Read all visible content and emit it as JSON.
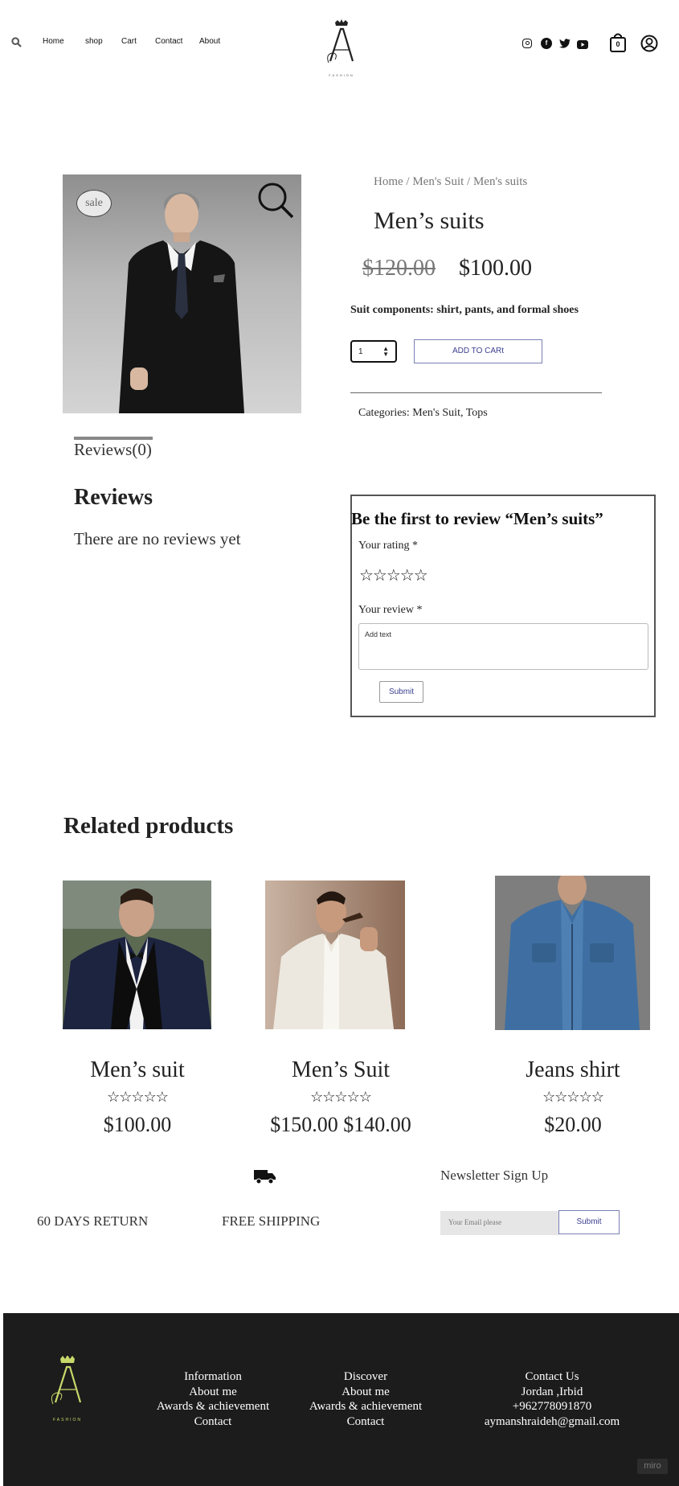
{
  "header": {
    "nav": [
      "Home",
      "shop",
      "Cart",
      "Contact",
      "About"
    ],
    "cart_count": "0",
    "logo_subtext": "FASHION"
  },
  "product": {
    "sale_badge": "sale",
    "breadcrumb": "Home / Men's Suit / Men's suits",
    "title": "Men’s suits",
    "old_price": "$120.00",
    "new_price": "$100.00",
    "components": "Suit components: shirt, pants, and formal shoes",
    "quantity": "1",
    "add_to_cart": "ADD TO CARt",
    "categories": "Categories: Men's Suit, Tops"
  },
  "reviews": {
    "tab": "Reviews(0)",
    "heading": "Reviews",
    "none": "There are no reviews yet",
    "form_title": "Be the first to review “Men’s suits”",
    "rating_label": "Your rating *",
    "stars": "☆☆☆☆☆",
    "review_label": "Your review *",
    "review_placeholder": "Add text",
    "submit": "Submit"
  },
  "related": {
    "heading": "Related products",
    "items": [
      {
        "name": "Men’s suit",
        "stars": "☆☆☆☆☆",
        "price": "$100.00"
      },
      {
        "name": "Men’s Suit",
        "stars": "☆☆☆☆☆",
        "price": "$150.00 $140.00"
      },
      {
        "name": "Jeans shirt",
        "stars": "☆☆☆☆☆",
        "price": "$20.00"
      }
    ]
  },
  "features": {
    "return": "60 DAYS RETURN",
    "shipping": "FREE SHIPPING",
    "newsletter": "Newsletter Sign Up",
    "email_placeholder": "Your Email please",
    "submit": "Submit"
  },
  "footer": {
    "logo_subtext": "FASHION",
    "col1": [
      "Information",
      "About me",
      "Awards & achievement",
      "Contact"
    ],
    "col2": [
      "Discover",
      "About me",
      "Awards & achievement",
      "Contact"
    ],
    "col3": [
      "Contact Us",
      "Jordan ,Irbid",
      "+962778091870",
      "aymanshraideh@gmail.com"
    ],
    "watermark": "miro"
  },
  "colors": {
    "accent": "#3b3f8f",
    "footer_bg": "#1c1c1c",
    "logo_gold": "#c8d86a"
  }
}
